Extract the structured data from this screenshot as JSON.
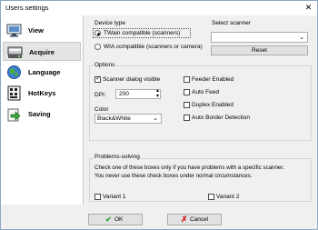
{
  "window": {
    "title": "Users settings",
    "close_glyph": "✕"
  },
  "sidebar": {
    "items": [
      {
        "label": "View",
        "icon": "monitor-icon",
        "selected": false
      },
      {
        "label": "Acquire",
        "icon": "scanner-icon",
        "selected": true
      },
      {
        "label": "Language",
        "icon": "globe-icon",
        "selected": false
      },
      {
        "label": "HotKeys",
        "icon": "keyboard-icon",
        "selected": false
      },
      {
        "label": "Saving",
        "icon": "save-arrow-icon",
        "selected": false
      }
    ]
  },
  "device_type": {
    "label": "Device type",
    "options": [
      {
        "label": "TWain compatible (scanners)",
        "selected": true
      },
      {
        "label": "WIA compatible (scanners or camera)",
        "selected": false
      }
    ]
  },
  "select_scanner": {
    "label": "Select scanner",
    "value": "",
    "reset_label": "Reset"
  },
  "options": {
    "label": "Options",
    "scanner_dialog_visible": {
      "label": "Scanner dialog visible",
      "checked": true
    },
    "dpi": {
      "label": "DPI:",
      "value": "200"
    },
    "color": {
      "label": "Color",
      "value": "Black&White"
    },
    "feeder_enabled": {
      "label": "Feeder Enabled",
      "checked": false
    },
    "auto_feed": {
      "label": "Auto Feed",
      "checked": false
    },
    "duplex_enabled": {
      "label": "Duplex Enabled",
      "checked": false
    },
    "auto_border_detection": {
      "label": "Auto Border Detection",
      "checked": false
    }
  },
  "problems": {
    "label": "Problems-solving",
    "line1": "Check one of these boxes only if you have problems with a specific scanner.",
    "line2": "You never use these check boxes under normal circumstances.",
    "variant1": {
      "label": "Variant 1",
      "checked": false
    },
    "variant2": {
      "label": "Variant 2",
      "checked": false
    }
  },
  "buttons": {
    "ok": "OK",
    "cancel": "Cancel"
  },
  "colors": {
    "ok_check": "#2e9b2e",
    "cancel_x": "#d42020",
    "selected_bg": "#e4e4e4"
  }
}
